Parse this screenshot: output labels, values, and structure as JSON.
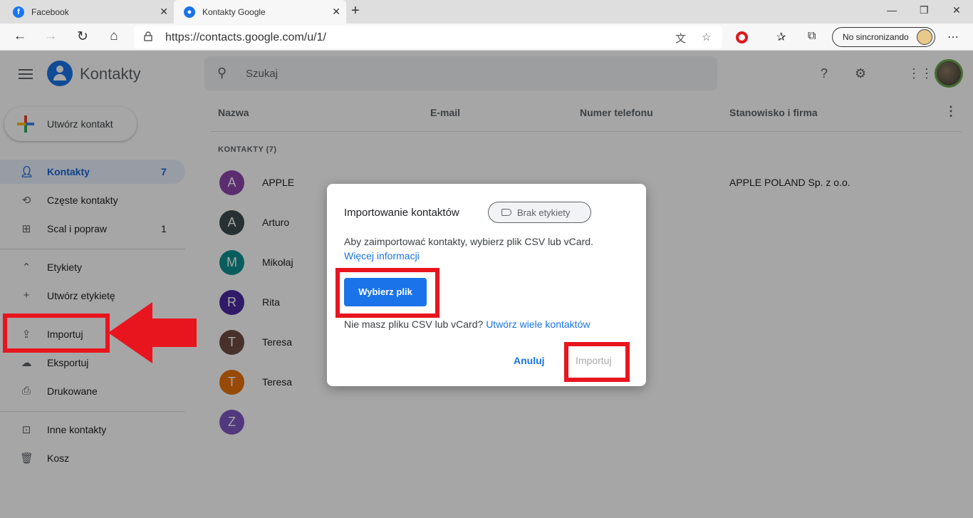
{
  "browser": {
    "tabs": [
      {
        "title": "Facebook"
      },
      {
        "title": "Kontakty Google"
      }
    ],
    "url": "https://contacts.google.com/u/1/",
    "sync_label": "No sincronizando"
  },
  "app": {
    "name": "Kontakty",
    "search_placeholder": "Szukaj",
    "create_contact": "Utwórz kontakt",
    "nav": {
      "contacts": {
        "label": "Kontakty",
        "count": "7"
      },
      "frequent": {
        "label": "Częste kontakty"
      },
      "merge": {
        "label": "Scal i popraw",
        "count": "1"
      },
      "labels": {
        "label": "Etykiety"
      },
      "create_label": {
        "label": "Utwórz etykietę"
      },
      "import": {
        "label": "Importuj"
      },
      "export": {
        "label": "Eksportuj"
      },
      "print": {
        "label": "Drukowane"
      },
      "other": {
        "label": "Inne kontakty"
      },
      "trash": {
        "label": "Kosz"
      }
    },
    "columns": {
      "name": "Nazwa",
      "email": "E-mail",
      "phone": "Numer telefonu",
      "job": "Stanowisko i firma"
    },
    "section_label": "KONTAKTY (7)",
    "contacts": [
      {
        "initial": "A",
        "name": "APPLE",
        "company": "APPLE POLAND Sp. z o.o.",
        "color": "#8e44ad"
      },
      {
        "initial": "A",
        "name": "Arturo",
        "company": "",
        "color": "#3c4a4f"
      },
      {
        "initial": "M",
        "name": "Mikołaj",
        "company": "",
        "color": "#0f8f8f"
      },
      {
        "initial": "R",
        "name": "Rita",
        "company": "",
        "color": "#4a2aa0"
      },
      {
        "initial": "T",
        "name": "Teresa",
        "company": "",
        "color": "#6d4c41"
      },
      {
        "initial": "T",
        "name": "Teresa",
        "company": "",
        "color": "#e8710a"
      },
      {
        "initial": "Z",
        "name": "",
        "company": "",
        "color": "#7e57c2"
      }
    ]
  },
  "dialog": {
    "title": "Importowanie kontaktów",
    "label_chip": "Brak etykiety",
    "description": "Aby zaimportować kontakty, wybierz plik CSV lub vCard.",
    "more_info": "Więcej informacji",
    "choose_file": "Wybierz plik",
    "no_file_text": "Nie masz pliku CSV lub vCard?",
    "create_many": "Utwórz wiele kontaktów",
    "cancel": "Anuluj",
    "import": "Importuj"
  },
  "colors": {
    "accent": "#1a73e8",
    "highlight": "#e8151f"
  }
}
